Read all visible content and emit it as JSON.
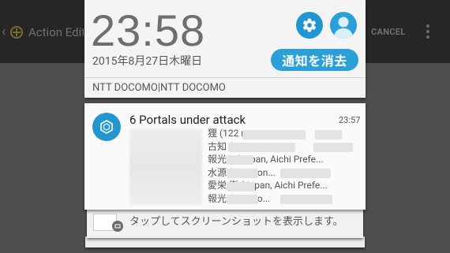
{
  "background_app": {
    "title": "Action Edit",
    "cancel_label": "CANCEL"
  },
  "quick_settings": {
    "time": "23:58",
    "date": "2015年8月27日木曜日",
    "clear_button": "通知を消去",
    "carrier": "NTT DOCOMO|NTT DOCOMO",
    "accent": "#2b9fd8"
  },
  "notification": {
    "title": "6 Portals under attack",
    "time": "23:57",
    "lines": [
      "狸 (122                                    na...",
      "古知                          (81              ...",
      "報光              1 (Japan, Aichi Prefe...",
      "水源              (168                   Hon...",
      "愛栄             街 (Japan, Aichi Prefe...",
      "報光              (113                    Ho..."
    ]
  },
  "screenshot_notice": {
    "text": "タップしてスクリーンショットを表示します。"
  }
}
